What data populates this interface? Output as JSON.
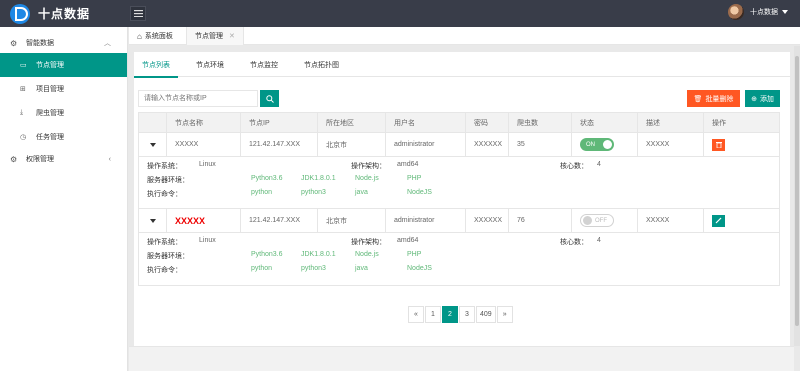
{
  "header": {
    "logo_text": "十点数据",
    "user_name": "十点数据"
  },
  "sidebar": {
    "groups": [
      {
        "label": "智能数据",
        "items": [
          {
            "label": "节点管理",
            "active": true
          },
          {
            "label": "项目管理"
          },
          {
            "label": "爬虫管理"
          },
          {
            "label": "任务管理"
          }
        ]
      },
      {
        "label": "权限管理"
      }
    ]
  },
  "tabs": {
    "home": "系统面板",
    "current": "节点管理"
  },
  "subtabs": [
    "节点列表",
    "节点环境",
    "节点监控",
    "节点拓扑图"
  ],
  "search": {
    "placeholder": "请输入节点名称或IP"
  },
  "buttons": {
    "batch_delete": "批量删除",
    "add": "添加"
  },
  "table": {
    "headers": [
      "节点名称",
      "节点IP",
      "所在地区",
      "用户名",
      "密码",
      "爬虫数",
      "状态",
      "描述",
      "操作"
    ],
    "rows": [
      {
        "name": "XXXXX",
        "ip": "121.42.147.XXX",
        "region": "北京市",
        "user": "administrator",
        "password": "XXXXXX",
        "spiders": "35",
        "status": "ON",
        "desc": "XXXXX",
        "detail": {
          "os_label": "操作系统：",
          "os": "Linux",
          "arch_label": "操作架构：",
          "arch": "amd64",
          "cores_label": "核心数：",
          "cores": "4",
          "env_label": "服务器环境：",
          "env": [
            "Python3.6",
            "JDK1.8.0.1",
            "Node.js",
            "PHP"
          ],
          "cmd_label": "执行命令：",
          "cmd": [
            "python",
            "python3",
            "java",
            "NodeJS"
          ]
        }
      },
      {
        "name": "XXXXX",
        "ip": "121.42.147.XXX",
        "region": "北京市",
        "user": "administrator",
        "password": "XXXXXX",
        "spiders": "76",
        "status": "OFF",
        "desc": "XXXXX",
        "detail": {
          "os_label": "操作系统：",
          "os": "Linux",
          "arch_label": "操作架构：",
          "arch": "amd64",
          "cores_label": "核心数：",
          "cores": "4",
          "env_label": "服务器环境：",
          "env": [
            "Python3.6",
            "JDK1.8.0.1",
            "Node.js",
            "PHP"
          ],
          "cmd_label": "执行命令：",
          "cmd": [
            "python",
            "python3",
            "java",
            "NodeJS"
          ]
        }
      }
    ]
  },
  "pagination": {
    "prev": "«",
    "pages": [
      "1",
      "2",
      "3",
      "409"
    ],
    "current": "2",
    "next": "»"
  },
  "colors": {
    "accent": "#009688",
    "danger": "#ff5722",
    "topbar": "#393d49",
    "success": "#5fb878"
  }
}
